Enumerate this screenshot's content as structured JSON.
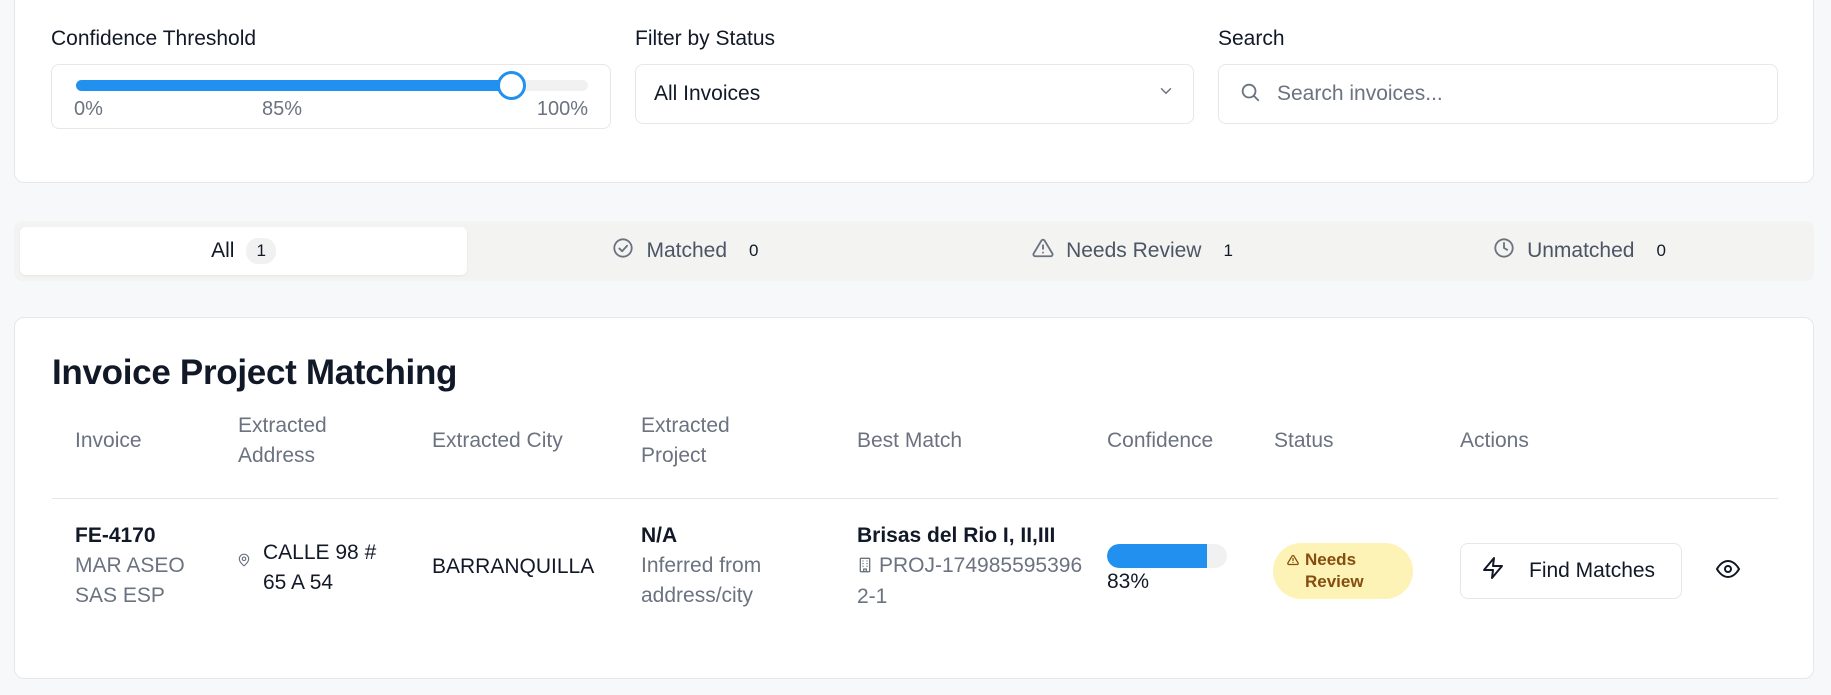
{
  "filters": {
    "confidence_label": "Confidence Threshold",
    "confidence_value": 85,
    "tick_min": "0%",
    "tick_mid": "85%",
    "tick_max": "100%",
    "status_label": "Filter by Status",
    "status_selected": "All Invoices",
    "search_label": "Search",
    "search_placeholder": "Search invoices..."
  },
  "tabs": [
    {
      "label": "All",
      "count": "1",
      "icon": "none"
    },
    {
      "label": "Matched",
      "count": "0",
      "icon": "check-circle-icon"
    },
    {
      "label": "Needs Review",
      "count": "1",
      "icon": "alert-triangle-icon"
    },
    {
      "label": "Unmatched",
      "count": "0",
      "icon": "clock-icon"
    }
  ],
  "table": {
    "title": "Invoice Project Matching",
    "headers": {
      "invoice": "Invoice",
      "address": "Extracted Address",
      "city": "Extracted City",
      "project": "Extracted Project",
      "best_match": "Best Match",
      "confidence": "Confidence",
      "status": "Status",
      "actions": "Actions"
    },
    "rows": [
      {
        "invoice_id": "FE-4170",
        "vendor": "MAR ASEO SAS ESP",
        "address": "CALLE 98 # 65 A 54",
        "city": "BARRANQUILLA",
        "project": "N/A",
        "project_note": "Inferred from address/city",
        "match_name": "Brisas del Rio I, II,III",
        "match_code": "PROJ-1749855953962-1",
        "confidence": 83,
        "confidence_text": "83%",
        "status": "Needs Review",
        "action_label": "Find Matches"
      }
    ]
  },
  "colors": {
    "accent": "#2190ee",
    "badge_bg": "#fdf3b7",
    "badge_text": "#854d0e"
  }
}
